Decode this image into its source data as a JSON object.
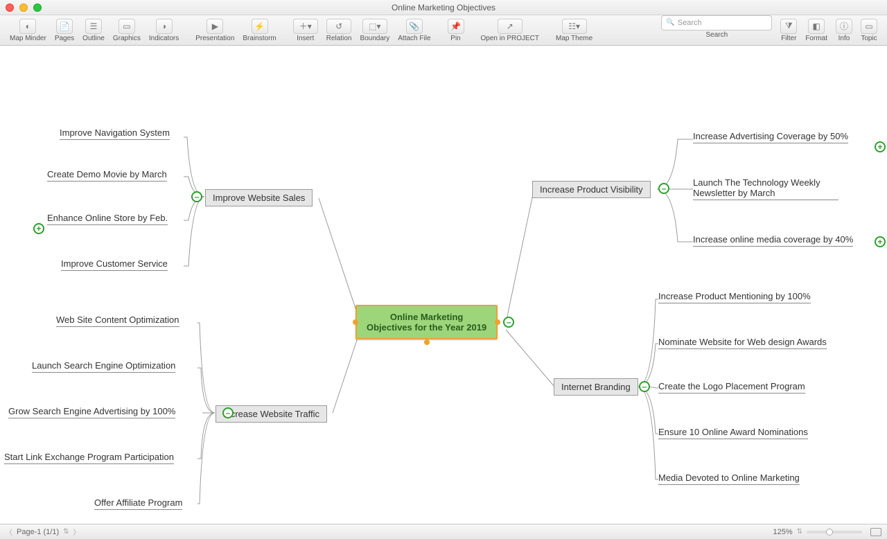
{
  "window": {
    "title": "Online Marketing Objectives"
  },
  "toolbar": {
    "map_minder": "Map Minder",
    "pages": "Pages",
    "outline": "Outline",
    "graphics": "Graphics",
    "indicators": "Indicators",
    "presentation": "Presentation",
    "brainstorm": "Brainstorm",
    "insert": "Insert",
    "relation": "Relation",
    "boundary": "Boundary",
    "attach_file": "Attach File",
    "pin": "Pin",
    "open_project": "Open in PROJECT",
    "map_theme": "Map Theme",
    "search_label": "Search",
    "search_placeholder": "Search",
    "filter": "Filter",
    "format": "Format",
    "info": "Info",
    "topic": "Topic"
  },
  "mindmap": {
    "central_1": "Online Marketing",
    "central_2": "Objectives for the Year 2019",
    "b1": "Improve Website Sales",
    "b2": "Increase Website Traffic",
    "b3": "Increase Product Visibility",
    "b4": "Internet Branding",
    "b1_items": [
      "Improve Navigation System",
      "Create Demo Movie by March",
      "Enhance Online Store by Feb.",
      "Improve Customer Service"
    ],
    "b2_items": [
      "Web Site Content Optimization",
      "Launch Search Engine Optimization",
      "Grow Search Engine Advertising by 100%",
      "Start Link Exchange Program Participation",
      "Offer Affiliate Program"
    ],
    "b3_items": [
      "Increase Advertising Coverage by 50%",
      "Launch The Technology Weekly Newsletter by March",
      "Increase online media coverage by 40%"
    ],
    "b4_items": [
      "Increase Product Mentioning by 100%",
      "Nominate Website for Web design Awards",
      "Create the Logo Placement Program",
      "Ensure 10 Online Award Nominations",
      "Media Devoted to Online Marketing"
    ]
  },
  "status": {
    "page_label": "Page-1 (1/1)",
    "zoom": "125%"
  },
  "colors": {
    "accent_green": "#2e9e2e",
    "central_bg": "#9dd67a",
    "central_border": "#f0a030"
  }
}
